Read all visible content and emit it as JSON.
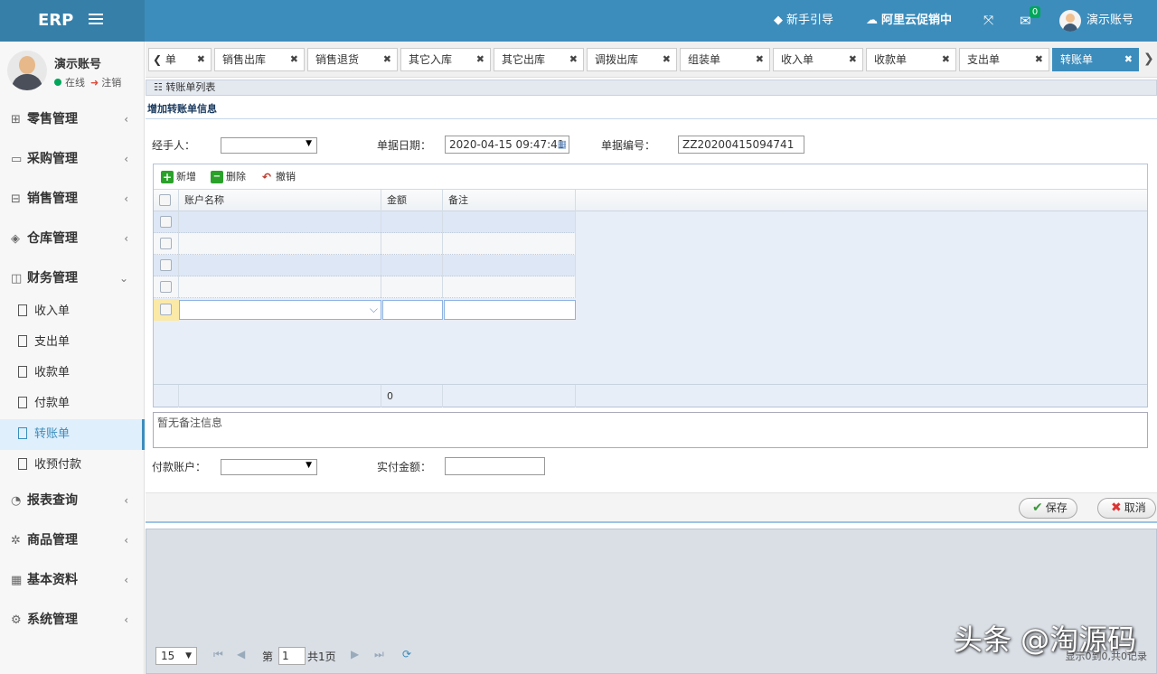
{
  "app": {
    "logo": "ERP"
  },
  "topbar": {
    "guide": "新手引导",
    "promo": "阿里云促销中",
    "mail_count": "0",
    "user": "演示账号"
  },
  "sidebar": {
    "user_name": "演示账号",
    "status": "在线",
    "logout": "注销",
    "menus": [
      {
        "label": "零售管理",
        "icon": "gift-icon"
      },
      {
        "label": "采购管理",
        "icon": "monitor-icon"
      },
      {
        "label": "销售管理",
        "icon": "briefcase-icon"
      },
      {
        "label": "仓库管理",
        "icon": "layers-icon"
      },
      {
        "label": "财务管理",
        "icon": "book-icon"
      },
      {
        "label": "报表查询",
        "icon": "pie-icon"
      },
      {
        "label": "商品管理",
        "icon": "settings-icon"
      },
      {
        "label": "基本资料",
        "icon": "grid-icon"
      },
      {
        "label": "系统管理",
        "icon": "gear-icon"
      }
    ],
    "finance_items": [
      "收入单",
      "支出单",
      "收款单",
      "付款单",
      "转账单",
      "收预付款"
    ]
  },
  "tabs": [
    "单",
    "销售出库",
    "销售退货",
    "其它入库",
    "其它出库",
    "调拨出库",
    "组装单",
    "收入单",
    "收款单",
    "支出单",
    "转账单"
  ],
  "content": {
    "list_title": "转账单列表",
    "section_title": "增加转账单信息",
    "handler_label": "经手人：",
    "date_label": "单据日期：",
    "date_value": "2020-04-15 09:47:41",
    "number_label": "单据编号：",
    "number_value": "ZZ20200415094741",
    "grid": {
      "add": "新增",
      "delete": "删除",
      "undo": "撤销",
      "col_account": "账户名称",
      "col_amount": "金额",
      "col_remark": "备注",
      "total": "0"
    },
    "remark_placeholder": "暂无备注信息",
    "pay_account_label": "付款账户：",
    "actual_amount_label": "实付金额：",
    "save": "保存",
    "cancel": "取消"
  },
  "pager": {
    "page_size": "15",
    "page_prefix": "第",
    "page_value": "1",
    "page_total": "共1页",
    "info": "显示0到0,共0记录"
  },
  "watermark": "头条 @淘源码",
  "colors": {
    "accent": "#3c8dbc",
    "sidebar_bg": "#f7f7f7",
    "grid_bg": "#e8eef7"
  }
}
